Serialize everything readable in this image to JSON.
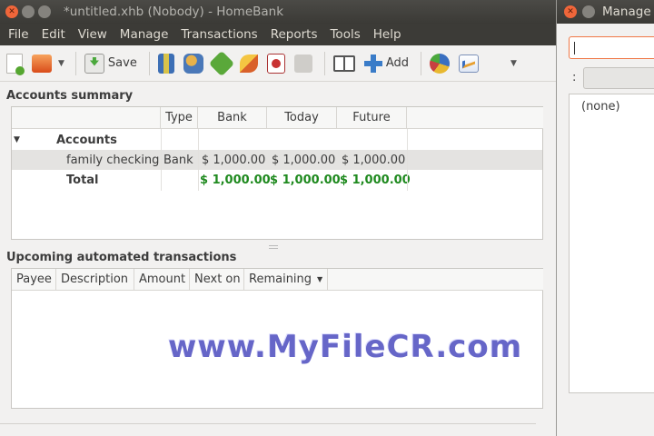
{
  "window": {
    "title": "*untitled.xhb (Nobody) - HomeBank"
  },
  "menu": [
    "File",
    "Edit",
    "View",
    "Manage",
    "Transactions",
    "Reports",
    "Tools",
    "Help"
  ],
  "toolbar": {
    "save_label": "Save",
    "add_label": "Add"
  },
  "accounts_summary": {
    "title": "Accounts summary",
    "columns": [
      "",
      "Type",
      "Bank",
      "Today",
      "Future"
    ],
    "group_label": "Accounts",
    "rows": [
      {
        "name": "family checking",
        "type": "Bank",
        "bank": "$ 1,000.00",
        "today": "$ 1,000.00",
        "future": "$ 1,000.00"
      }
    ],
    "total": {
      "name": "Total",
      "bank": "$ 1,000.00",
      "today": "$ 1,000.00",
      "future": "$ 1,000.00"
    }
  },
  "upcoming": {
    "title": "Upcoming automated transactions",
    "columns": [
      "Payee",
      "Description",
      "Amount",
      "Next on",
      "Remaining"
    ]
  },
  "side_window": {
    "title": "Manage",
    "colon": ":",
    "list_item": "(none)"
  },
  "watermark": "www.MyFileCR.com",
  "colors": {
    "titlebar": "#3c3b37",
    "close_button": "#f0663a",
    "amount_green": "#1f8a1f",
    "watermark": "#6666c8"
  }
}
